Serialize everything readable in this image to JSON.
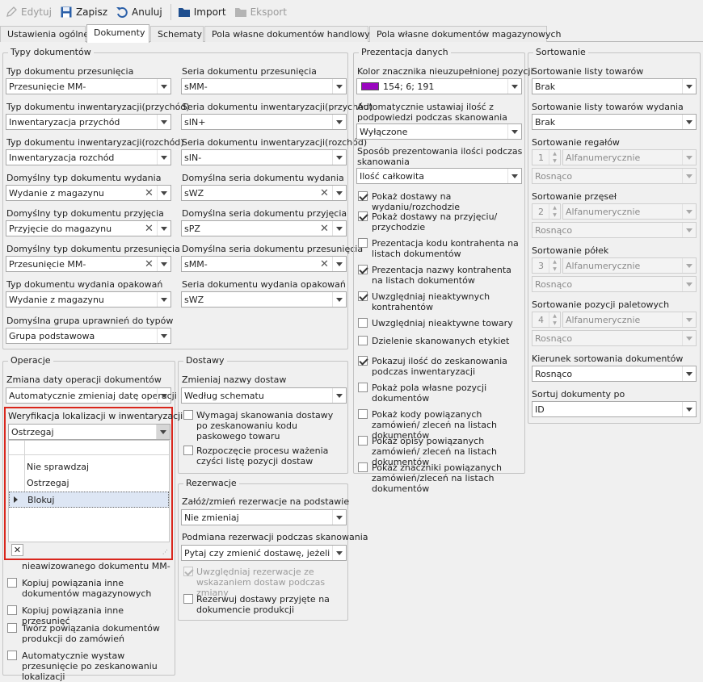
{
  "toolbar": {
    "edit": "Edytuj",
    "save": "Zapisz",
    "cancel": "Anuluj",
    "import": "Import",
    "export": "Eksport"
  },
  "tabs": [
    "Ustawienia ogólne",
    "Dokumenty",
    "Schematy",
    "Pola własne dokumentów handlowych",
    "Pola własne dokumentów magazynowych"
  ],
  "types": {
    "legend": "Typy dokumentów",
    "rows": [
      {
        "l1": "Typ dokumentu przesunięcia",
        "v1": "Przesunięcie MM-",
        "l2": "Seria dokumentu przesunięcia",
        "v2": "sMM-"
      },
      {
        "l1": "Typ dokumentu inwentaryzacji(przychód)",
        "v1": "Inwentaryzacja przychód",
        "l2": "Seria dokumentu inwentaryzacji(przychód)",
        "v2": "sIN+"
      },
      {
        "l1": "Typ dokumentu inwentaryzacji(rozchód)",
        "v1": "Inwentaryzacja rozchód",
        "l2": "Seria dokumentu inwentaryzacji(rozchód)",
        "v2": "sIN-"
      },
      {
        "l1": "Domyślny typ dokumentu wydania",
        "v1": "Wydanie z magazynu",
        "l2": "Domyślna seria dokumentu wydania",
        "v2": "sWZ"
      },
      {
        "l1": "Domyślny typ dokumentu przyjęcia",
        "v1": "Przyjęcie do magazynu",
        "l2": "Domyślna seria dokumentu przyjęcia",
        "v2": "sPZ"
      },
      {
        "l1": "Domyślny typ dokumentu przesunięcia",
        "v1": "Przesunięcie MM-",
        "l2": "Domyślna seria dokumentu przesunięcia",
        "v2": "sMM-"
      },
      {
        "l1": "Typ dokumentu wydania opakowań",
        "v1": "Wydanie z magazynu",
        "l2": "Seria dokumentu wydania opakowań",
        "v2": "sWZ"
      }
    ],
    "perm_label": "Domyślna grupa uprawnień do typów",
    "perm_value": "Grupa podstawowa"
  },
  "ops": {
    "legend": "Operacje",
    "date_label": "Zmiana daty operacji dokumentów",
    "date_value": "Automatycznie zmieniaj datę operacji",
    "loc_label": "Weryfikacja lokalizacji w inwentaryzacji",
    "loc_value": "Ostrzegaj",
    "options": [
      "Nie sprawdzaj",
      "Ostrzegaj",
      "Blokuj"
    ],
    "hidden_tail": "nieawizowanego dokumentu MM-",
    "checks": [
      {
        "text": "Kopiuj powiązania inne dokumentów magazynowych"
      },
      {
        "text": "Kopiuj powiązania inne przesunięć"
      },
      {
        "text": "Twórz powiązania dokumentów produkcji do zamówień"
      },
      {
        "text": "Automatycznie wystaw przesunięcie po zeskanowaniu lokalizacji"
      }
    ]
  },
  "delivery": {
    "legend": "Dostawy",
    "name_label": "Zmieniaj nazwy dostaw",
    "name_value": "Według schematu",
    "checks": [
      {
        "text": "Wymagaj skanowania dostawy po zeskanowaniu kodu paskowego towaru"
      },
      {
        "text": "Rozpoczęcie procesu ważenia czyści listę pozycji dostaw"
      }
    ]
  },
  "res": {
    "legend": "Rezerwacje",
    "create_label": "Załóż/zmień rezerwacje na podstawie",
    "create_value": "Nie zmieniaj",
    "swap_label": "Podmiana rezerwacji podczas skanowania",
    "swap_value": "Pytaj czy zmienić dostawę, jeżeli ze...",
    "checks": [
      {
        "text": "Uwzględniaj rezerwacje ze wskazaniem dostaw podczas zmiany"
      },
      {
        "text": "Rezerwuj dostawy przyjęte na dokumencie produkcji"
      }
    ]
  },
  "pres": {
    "legend": "Prezentacja danych",
    "color_label": "Kolor znacznika nieuzupełnionej pozycji",
    "color_value": "154; 6; 191",
    "color_hex": "#9a06bf",
    "auto_label": "Automatycznie ustawiaj ilość z podpowiedzi podczas skanowania",
    "auto_value": "Wyłączone",
    "qty_label": "Sposób prezentowania ilości podczas skanowania",
    "qty_value": "Ilość całkowita",
    "checks": [
      {
        "text": "Pokaż dostawy na wydaniu/rozchodzie",
        "checked": true
      },
      {
        "text": "Pokaż dostawy na przyjęciu/ przychodzie",
        "checked": true
      },
      {
        "text": "Prezentacja kodu kontrahenta na listach dokumentów",
        "checked": false
      },
      {
        "text": "Prezentacja nazwy kontrahenta na listach dokumentów",
        "checked": true
      },
      {
        "text": "Uwzględniaj nieaktywnych kontrahentów",
        "checked": true
      },
      {
        "text": "Uwzględniaj nieaktywne towary",
        "checked": false
      },
      {
        "text": "Dzielenie skanowanych etykiet",
        "checked": false
      },
      {
        "text": "Pokazuj ilość do zeskanowania podczas inwentaryzacji",
        "checked": true
      },
      {
        "text": "Pokaż pola własne pozycji dokumentów",
        "checked": false
      },
      {
        "text": "Pokaż kody powiązanych zamówień/ zleceń na listach dokumentów",
        "checked": false
      },
      {
        "text": "Pokaż opisy powiązanych zamówień/ zleceń na listach dokumentów",
        "checked": false
      },
      {
        "text": "Pokaż znaczniki powiązanych zamówień/zleceń na listach dokumentów",
        "checked": false
      }
    ]
  },
  "sort": {
    "legend": "Sortowanie",
    "list_label": "Sortowanie listy towarów",
    "list_value": "Brak",
    "issue_label": "Sortowanie listy towarów wydania",
    "issue_value": "Brak",
    "groups": [
      {
        "label": "Sortowanie regałów",
        "num": "1",
        "field": "Alfanumerycznie",
        "order": "Rosnąco"
      },
      {
        "label": "Sortowanie przęseł",
        "num": "2",
        "field": "Alfanumerycznie",
        "order": "Rosnąco"
      },
      {
        "label": "Sortowanie półek",
        "num": "3",
        "field": "Alfanumerycznie",
        "order": "Rosnąco"
      },
      {
        "label": "Sortowanie pozycji paletowych",
        "num": "4",
        "field": "Alfanumerycznie",
        "order": "Rosnąco"
      }
    ],
    "dir_label": "Kierunek sortowania dokumentów",
    "dir_value": "Rosnąco",
    "by_label": "Sortuj dokumenty po",
    "by_value": "ID"
  }
}
